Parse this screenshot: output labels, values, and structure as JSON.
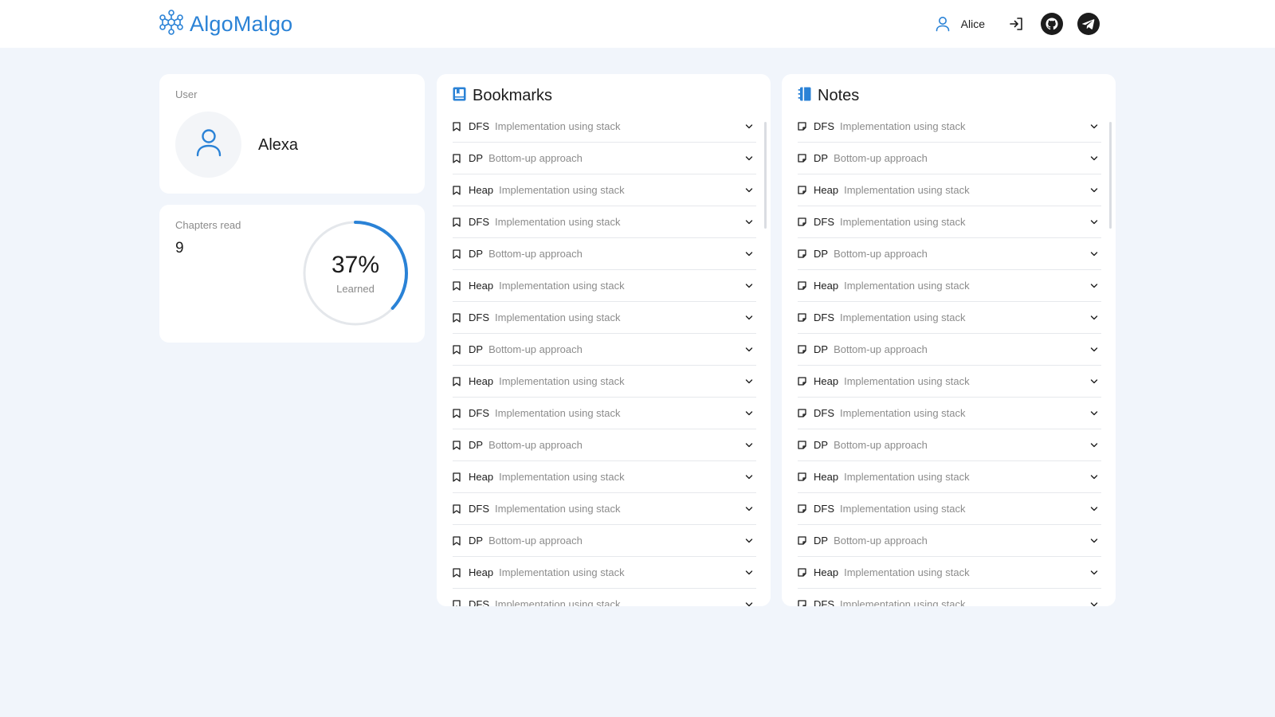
{
  "header": {
    "brand": "AlgoMalgo",
    "user_name": "Alice",
    "icons": [
      "logo-icon",
      "user-icon",
      "login-icon",
      "github-icon",
      "telegram-icon"
    ]
  },
  "user_card": {
    "label": "User",
    "display_name": "Alexa"
  },
  "progress_card": {
    "label": "Chapters read",
    "chapters_read": "9",
    "percent_text": "37%",
    "percent_value": 0.37,
    "sub_label": "Learned"
  },
  "bookmarks": {
    "title": "Bookmarks",
    "items": [
      {
        "tag": "DFS",
        "desc": "Implementation using stack"
      },
      {
        "tag": "DP",
        "desc": "Bottom-up approach"
      },
      {
        "tag": "Heap",
        "desc": "Implementation using stack"
      },
      {
        "tag": "DFS",
        "desc": "Implementation using stack"
      },
      {
        "tag": "DP",
        "desc": "Bottom-up approach"
      },
      {
        "tag": "Heap",
        "desc": "Implementation using stack"
      },
      {
        "tag": "DFS",
        "desc": "Implementation using stack"
      },
      {
        "tag": "DP",
        "desc": "Bottom-up approach"
      },
      {
        "tag": "Heap",
        "desc": "Implementation using stack"
      },
      {
        "tag": "DFS",
        "desc": "Implementation using stack"
      },
      {
        "tag": "DP",
        "desc": "Bottom-up approach"
      },
      {
        "tag": "Heap",
        "desc": "Implementation using stack"
      },
      {
        "tag": "DFS",
        "desc": "Implementation using stack"
      },
      {
        "tag": "DP",
        "desc": "Bottom-up approach"
      },
      {
        "tag": "Heap",
        "desc": "Implementation using stack"
      },
      {
        "tag": "DFS",
        "desc": "Implementation using stack"
      }
    ]
  },
  "notes": {
    "title": "Notes",
    "items": [
      {
        "tag": "DFS",
        "desc": "Implementation using stack"
      },
      {
        "tag": "DP",
        "desc": "Bottom-up approach"
      },
      {
        "tag": "Heap",
        "desc": "Implementation using stack"
      },
      {
        "tag": "DFS",
        "desc": "Implementation using stack"
      },
      {
        "tag": "DP",
        "desc": "Bottom-up approach"
      },
      {
        "tag": "Heap",
        "desc": "Implementation using stack"
      },
      {
        "tag": "DFS",
        "desc": "Implementation using stack"
      },
      {
        "tag": "DP",
        "desc": "Bottom-up approach"
      },
      {
        "tag": "Heap",
        "desc": "Implementation using stack"
      },
      {
        "tag": "DFS",
        "desc": "Implementation using stack"
      },
      {
        "tag": "DP",
        "desc": "Bottom-up approach"
      },
      {
        "tag": "Heap",
        "desc": "Implementation using stack"
      },
      {
        "tag": "DFS",
        "desc": "Implementation using stack"
      },
      {
        "tag": "DP",
        "desc": "Bottom-up approach"
      },
      {
        "tag": "Heap",
        "desc": "Implementation using stack"
      },
      {
        "tag": "DFS",
        "desc": "Implementation using stack"
      }
    ]
  },
  "colors": {
    "accent": "#2a82d6",
    "background": "#f1f5fb",
    "card": "#ffffff",
    "muted_text": "#8a8a8a",
    "ring_track": "#e4e7eb"
  }
}
